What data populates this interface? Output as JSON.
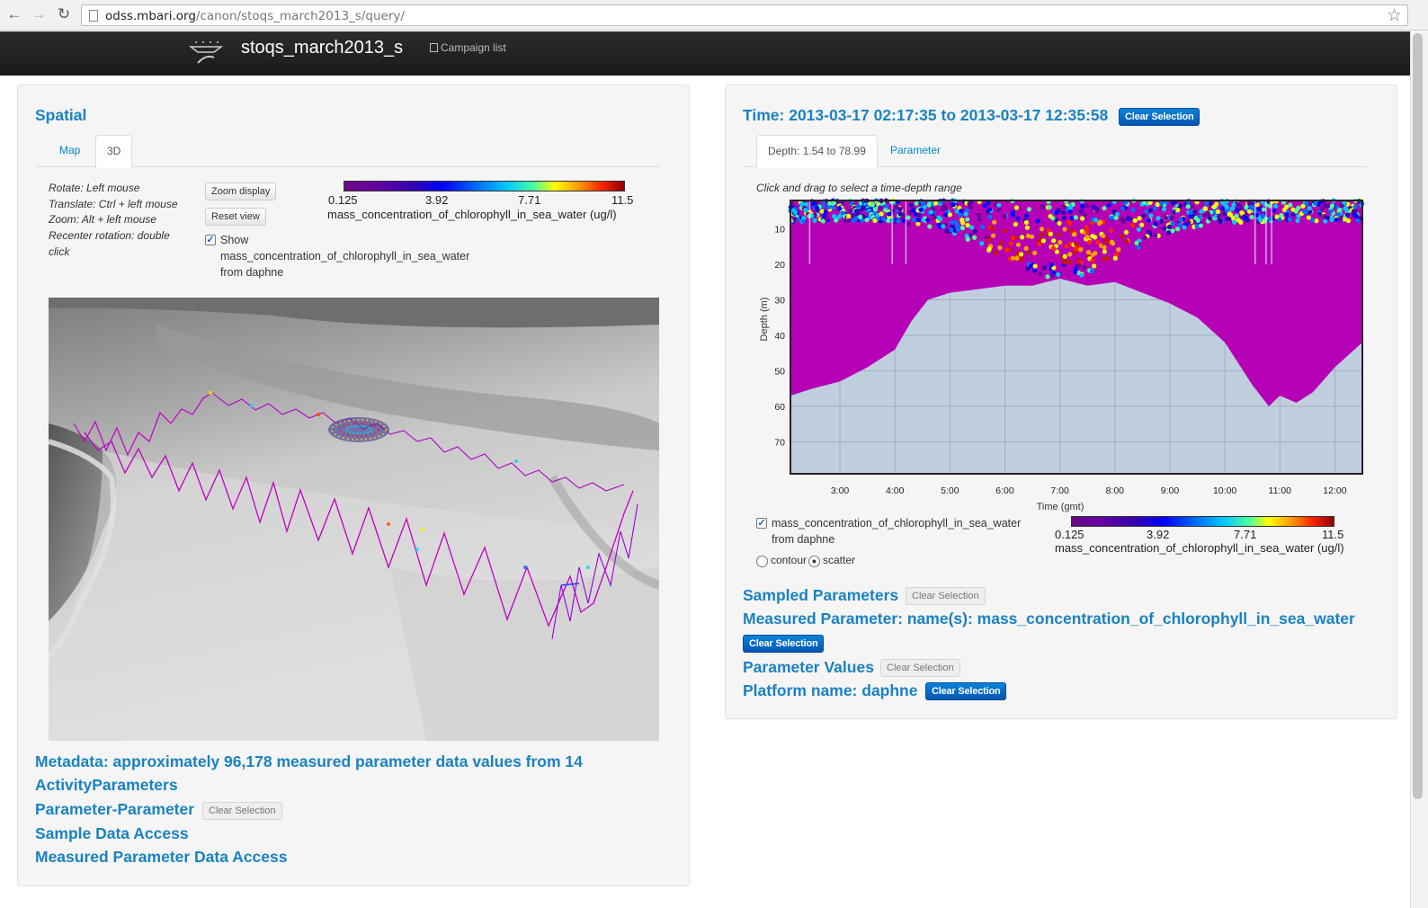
{
  "browser": {
    "url_host": "odss.mbari.org",
    "url_path": "/canon/stoqs_march2013_s/query/"
  },
  "navbar": {
    "brand": "stoqs_march2013_s",
    "campaign_link": "Campaign list"
  },
  "spatial": {
    "heading": "Spatial",
    "tabs": [
      {
        "label": "Map",
        "active": false
      },
      {
        "label": "3D",
        "active": true
      }
    ],
    "instructions": [
      "Rotate: Left mouse",
      "Translate: Ctrl + left mouse",
      "Zoom: Alt + left mouse",
      "Recenter rotation: double click"
    ],
    "zoom_button": "Zoom display",
    "reset_button": "Reset view",
    "show_checkbox": {
      "checked": true,
      "label_line1": "Show",
      "label_line2": "mass_concentration_of_chlorophyll_in_sea_water",
      "label_line3": "from daphne"
    },
    "colorbar": {
      "ticks": [
        "0.125",
        "3.92",
        "7.71",
        "11.5"
      ],
      "label": "mass_concentration_of_chlorophyll_in_sea_water (ug/l)"
    }
  },
  "left_sections": {
    "metadata_line1": "Metadata: approximately 96,178 measured parameter data values from 14",
    "activity_parameters": "ActivityParameters",
    "parameter_parameter": "Parameter-Parameter",
    "pp_clear": "Clear Selection",
    "sample_access": "Sample Data Access",
    "measured_access": "Measured Parameter Data Access"
  },
  "time": {
    "heading": "Time: 2013-03-17 02:17:35 to 2013-03-17 12:35:58",
    "clear": "Clear Selection",
    "tabs": [
      {
        "label": "Depth: 1.54 to 78.99",
        "active": true
      },
      {
        "label": "Parameter",
        "active": false
      }
    ],
    "instruction": "Click and drag to select a time-depth range",
    "checkbox_label_line1": "mass_concentration_of_chlorophyll_in_sea_water",
    "checkbox_label_line2": "from daphne",
    "radio_contour": "contour",
    "radio_scatter": "scatter",
    "selected_plot": "scatter"
  },
  "chart_data": {
    "type": "scatter",
    "title": "",
    "xlabel": "Time (gmt)",
    "ylabel": "Depth (m)",
    "x_ticks": [
      "3:00",
      "4:00",
      "5:00",
      "6:00",
      "7:00",
      "8:00",
      "9:00",
      "10:00",
      "11:00",
      "12:00"
    ],
    "y_ticks": [
      10,
      20,
      30,
      40,
      50,
      60,
      70
    ],
    "ylim": [
      79,
      2
    ],
    "xlim_hours": [
      2.1,
      12.5
    ],
    "colorbar": {
      "ticks": [
        "0.125",
        "3.92",
        "7.71",
        "11.5"
      ],
      "label": "mass_concentration_of_chlorophyll_in_sea_water (ug/l)"
    },
    "max_depth_profile": {
      "hours": [
        2.1,
        2.5,
        3.0,
        3.5,
        4.0,
        4.3,
        4.6,
        5.0,
        5.5,
        6.0,
        6.5,
        7.0,
        7.5,
        8.0,
        8.5,
        9.0,
        9.5,
        10.0,
        10.5,
        10.8,
        11.0,
        11.3,
        11.6,
        12.0,
        12.5
      ],
      "depth": [
        57,
        55,
        53,
        49,
        44,
        36,
        30,
        28,
        27,
        26,
        26,
        24,
        26,
        25,
        28,
        31,
        35,
        42,
        54,
        60,
        57,
        59,
        56,
        49,
        42
      ]
    },
    "colors": {
      "background": "#bfcfe0",
      "low": "#b500b5",
      "high": "#c41a00"
    }
  },
  "right_sections": {
    "sampled": "Sampled Parameters",
    "sampled_clear": "Clear Selection",
    "measured": "Measured Parameter: name(s): mass_concentration_of_chlorophyll_in_sea_water",
    "measured_clear": "Clear Selection",
    "values": "Parameter Values",
    "values_clear": "Clear Selection",
    "platform": "Platform name: daphne",
    "platform_clear": "Clear Selection"
  }
}
